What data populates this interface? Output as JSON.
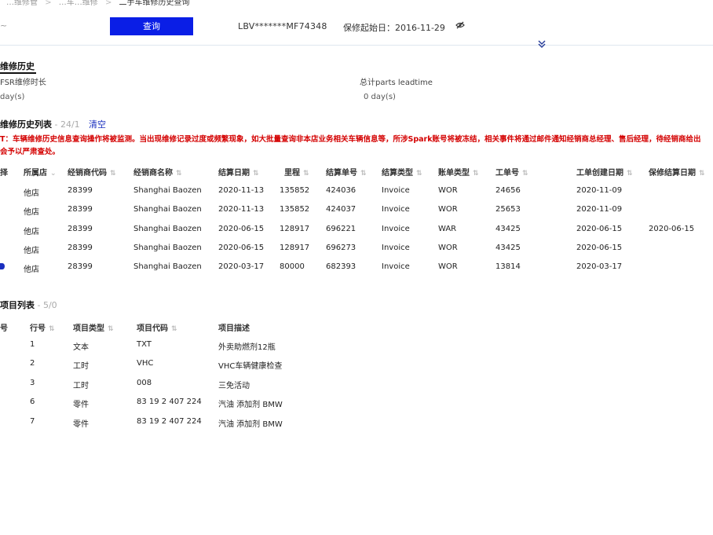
{
  "breadcrumb": {
    "item1": "…维修管",
    "item2": "…车…维修",
    "current": "二手车维修历史查询"
  },
  "search": {
    "button_label": "查询",
    "left_fragment": "~"
  },
  "vehicle": {
    "vin": "LBV*******MF74348",
    "warranty_start_label": "保修起始日：",
    "warranty_start_date": "2016-11-29"
  },
  "history_summary": {
    "title": "维修历史",
    "fields": [
      {
        "label": "FSR维修时长",
        "value": "day(s)"
      },
      {
        "label": "总计parts leadtime",
        "value": "0 day(s)"
      }
    ]
  },
  "history_list": {
    "title": "维修历史列表",
    "count": " - 24/1",
    "clear_label": "清空",
    "warning_line1": "T：车辆维修历史信息查询操作将被监测。当出现维修记录过度或频繁现象，如大批量查询非本店业务相关车辆信息等，所涉Spark账号将被冻结，相关事件将通过邮件通知经销商总经理、售后经理，待经销商给出",
    "warning_line2": "会予以严肃查处。",
    "columns": [
      "择",
      "所属店",
      "经销商代码",
      "经销商名称",
      "结算日期",
      "里程",
      "结算单号",
      "结算类型",
      "账单类型",
      "工单号",
      "工单创建日期",
      "保修结算日期"
    ],
    "rows": [
      {
        "store": "他店",
        "dealer_code": "28399",
        "dealer_name": "Shanghai Baozen",
        "settle_date": "2020-11-13",
        "mileage": "135852",
        "settle_no": "424036",
        "settle_type": "Invoice",
        "bill_type": "WOR",
        "wo_no": "24656",
        "wo_date": "2020-11-09",
        "warranty_date": ""
      },
      {
        "store": "他店",
        "dealer_code": "28399",
        "dealer_name": "Shanghai Baozen",
        "settle_date": "2020-11-13",
        "mileage": "135852",
        "settle_no": "424037",
        "settle_type": "Invoice",
        "bill_type": "WOR",
        "wo_no": "25653",
        "wo_date": "2020-11-09",
        "warranty_date": ""
      },
      {
        "store": "他店",
        "dealer_code": "28399",
        "dealer_name": "Shanghai Baozen",
        "settle_date": "2020-06-15",
        "mileage": "128917",
        "settle_no": "696221",
        "settle_type": "Invoice",
        "bill_type": "WAR",
        "wo_no": "43425",
        "wo_date": "2020-06-15",
        "warranty_date": "2020-06-15"
      },
      {
        "store": "他店",
        "dealer_code": "28399",
        "dealer_name": "Shanghai Baozen",
        "settle_date": "2020-06-15",
        "mileage": "128917",
        "settle_no": "696273",
        "settle_type": "Invoice",
        "bill_type": "WOR",
        "wo_no": "43425",
        "wo_date": "2020-06-15",
        "warranty_date": ""
      },
      {
        "store": "他店",
        "dealer_code": "28399",
        "dealer_name": "Shanghai Baozen",
        "settle_date": "2020-03-17",
        "mileage": "80000",
        "settle_no": "682393",
        "settle_type": "Invoice",
        "bill_type": "WOR",
        "wo_no": "13814",
        "wo_date": "2020-03-17",
        "warranty_date": ""
      }
    ]
  },
  "items_list": {
    "title": "项目列表",
    "count": " - 5/0",
    "columns": [
      "号",
      "行号",
      "项目类型",
      "项目代码",
      "项目描述"
    ],
    "rows": [
      {
        "line": "1",
        "type": "文本",
        "code": "TXT",
        "desc": "外卖助燃剂12瓶"
      },
      {
        "line": "2",
        "type": "工时",
        "code": "VHC",
        "desc": "VHC车辆健康检查"
      },
      {
        "line": "3",
        "type": "工时",
        "code": "008",
        "desc": "三免活动"
      },
      {
        "line": "6",
        "type": "零件",
        "code": "83 19 2 407 224",
        "desc": "汽油 添加剂 BMW"
      },
      {
        "line": "7",
        "type": "零件",
        "code": "83 19 2 407 224",
        "desc": "汽油 添加剂 BMW"
      }
    ]
  },
  "icons": {
    "eye": "eye-slash-icon",
    "chevron": "double-chevron-down-icon",
    "sort": "sort-icon",
    "filter": "chevron-down-icon"
  },
  "colors": {
    "accent": "#0a1ee6",
    "warning": "#d40000",
    "link": "#1a2fbf"
  }
}
